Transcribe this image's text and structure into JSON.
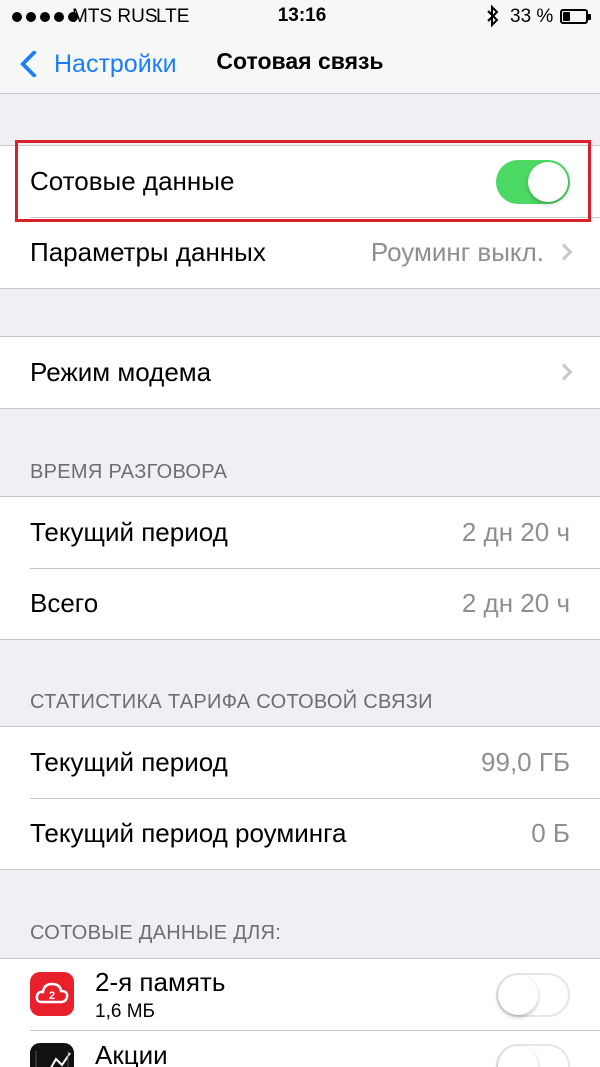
{
  "status_bar": {
    "carrier": "MTS RUS",
    "network": "LTE",
    "time": "13:16",
    "battery_percent": "33 %",
    "battery_level": 0.33,
    "bluetooth_icon": "bluetooth-icon"
  },
  "nav": {
    "back_label": "Настройки",
    "title": "Сотовая связь"
  },
  "colors": {
    "accent": "#1a7efb",
    "toggle_on": "#4cd964",
    "highlight": "#d9202b"
  },
  "cellular": {
    "data_label": "Сотовые данные",
    "data_enabled": true,
    "options_label": "Параметры данных",
    "options_value": "Роуминг выкл."
  },
  "modem": {
    "label": "Режим модема"
  },
  "call_time": {
    "header": "ВРЕМЯ РАЗГОВОРА",
    "rows": [
      {
        "label": "Текущий период",
        "value": "2 дн 20 ч"
      },
      {
        "label": "Всего",
        "value": "2 дн 20 ч"
      }
    ]
  },
  "usage": {
    "header": "СТАТИСТИКА ТАРИФА СОТОВОЙ СВЯЗИ",
    "rows": [
      {
        "label": "Текущий период",
        "value": "99,0 ГБ"
      },
      {
        "label": "Текущий период роуминга",
        "value": "0 Б"
      }
    ]
  },
  "apps": {
    "header": "СОТОВЫЕ ДАННЫЕ ДЛЯ:",
    "items": [
      {
        "name": "2-я память",
        "size": "1,6 МБ",
        "icon": "cloud-2-icon",
        "enabled": false
      },
      {
        "name": "Акции",
        "icon": "stocks-icon",
        "enabled": false
      }
    ]
  }
}
